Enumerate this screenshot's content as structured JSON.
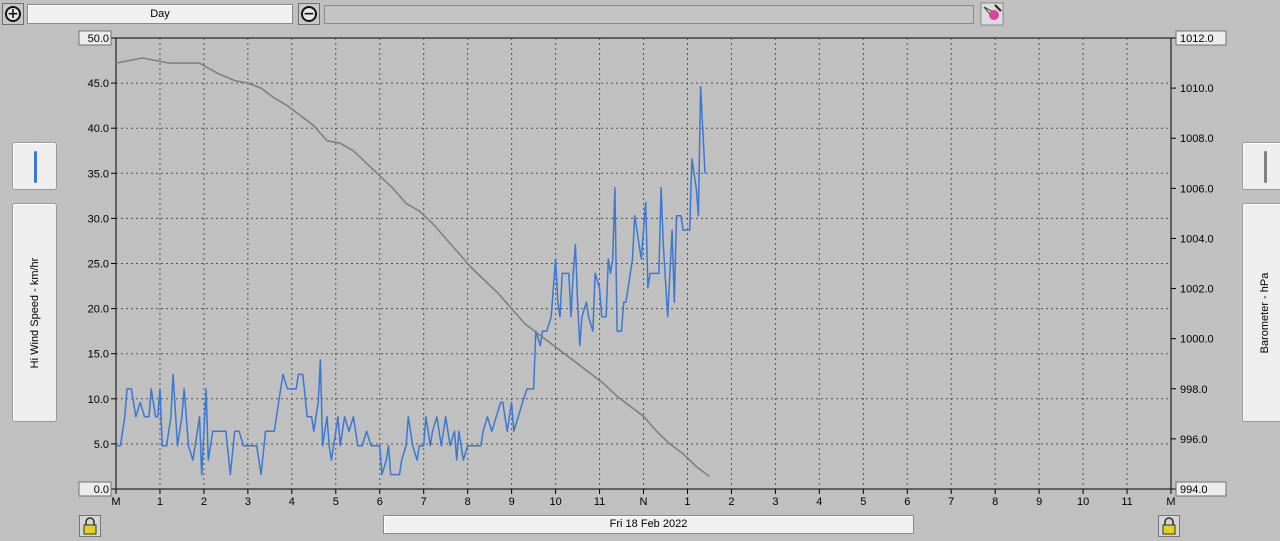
{
  "toolbar": {
    "period": "Day",
    "zoom_in_icon": "zoom-in-icon",
    "zoom_out_icon": "zoom-out-icon",
    "settings_icon": "paint-tool-icon"
  },
  "footer": {
    "date": "Fri 18 Feb 2022"
  },
  "left_panel": {
    "label": "Hi Wind Speed - km/hr",
    "color": "#3a78d4"
  },
  "right_panel": {
    "label": "Barometer - hPa",
    "color": "#808080"
  },
  "chart_data": {
    "type": "line",
    "left_axis": {
      "label": "Hi Wind Speed - km/hr",
      "min": 0,
      "max": 50,
      "ticks": [
        "0.0",
        "5.0",
        "10.0",
        "15.0",
        "20.0",
        "25.0",
        "30.0",
        "35.0",
        "40.0",
        "45.0",
        "50.0"
      ]
    },
    "right_axis": {
      "label": "Barometer - hPa",
      "min": 994,
      "max": 1012,
      "ticks": [
        "994.0",
        "996.0",
        "998.0",
        "1000.0",
        "1002.0",
        "1004.0",
        "1006.0",
        "1008.0",
        "1010.0",
        "1012.0"
      ]
    },
    "x_axis": {
      "min": 0,
      "max": 24,
      "ticks": [
        "M",
        "1",
        "2",
        "3",
        "4",
        "5",
        "6",
        "7",
        "8",
        "9",
        "10",
        "11",
        "N",
        "1",
        "2",
        "3",
        "4",
        "5",
        "6",
        "7",
        "8",
        "9",
        "10",
        "11",
        "M"
      ]
    },
    "grid": true,
    "series": [
      {
        "name": "Hi Wind Speed - km/hr",
        "axis": "left",
        "color": "#3a78d4",
        "points": [
          [
            0,
            4.8
          ],
          [
            0.1,
            4.8
          ],
          [
            0.2,
            8.0
          ],
          [
            0.25,
            11.1
          ],
          [
            0.35,
            11.1
          ],
          [
            0.45,
            8.0
          ],
          [
            0.55,
            9.6
          ],
          [
            0.65,
            8.0
          ],
          [
            0.75,
            8.0
          ],
          [
            0.8,
            11.1
          ],
          [
            0.9,
            8.0
          ],
          [
            0.95,
            8.0
          ],
          [
            1.0,
            11.1
          ],
          [
            1.05,
            4.8
          ],
          [
            1.15,
            4.8
          ],
          [
            1.25,
            8.0
          ],
          [
            1.3,
            12.7
          ],
          [
            1.4,
            4.8
          ],
          [
            1.5,
            8.0
          ],
          [
            1.55,
            11.1
          ],
          [
            1.65,
            4.8
          ],
          [
            1.75,
            3.2
          ],
          [
            1.85,
            6.4
          ],
          [
            1.9,
            8.0
          ],
          [
            1.95,
            1.6
          ],
          [
            2.05,
            11.1
          ],
          [
            2.1,
            3.2
          ],
          [
            2.2,
            6.4
          ],
          [
            2.3,
            6.4
          ],
          [
            2.4,
            6.4
          ],
          [
            2.5,
            6.4
          ],
          [
            2.6,
            1.6
          ],
          [
            2.7,
            6.4
          ],
          [
            2.8,
            6.4
          ],
          [
            2.9,
            4.8
          ],
          [
            3.0,
            4.8
          ],
          [
            3.1,
            4.8
          ],
          [
            3.2,
            4.8
          ],
          [
            3.3,
            1.6
          ],
          [
            3.4,
            6.4
          ],
          [
            3.5,
            6.4
          ],
          [
            3.6,
            6.4
          ],
          [
            3.7,
            9.6
          ],
          [
            3.8,
            12.7
          ],
          [
            3.9,
            11.1
          ],
          [
            4.0,
            11.1
          ],
          [
            4.1,
            11.1
          ],
          [
            4.15,
            12.7
          ],
          [
            4.25,
            12.7
          ],
          [
            4.35,
            8.0
          ],
          [
            4.45,
            8.0
          ],
          [
            4.5,
            6.4
          ],
          [
            4.6,
            9.6
          ],
          [
            4.65,
            14.3
          ],
          [
            4.7,
            4.8
          ],
          [
            4.8,
            8.0
          ],
          [
            4.85,
            4.8
          ],
          [
            4.9,
            3.2
          ],
          [
            5.0,
            6.4
          ],
          [
            5.05,
            8.0
          ],
          [
            5.1,
            4.8
          ],
          [
            5.2,
            8.0
          ],
          [
            5.3,
            6.4
          ],
          [
            5.4,
            8.0
          ],
          [
            5.5,
            4.8
          ],
          [
            5.6,
            4.8
          ],
          [
            5.7,
            6.4
          ],
          [
            5.8,
            4.8
          ],
          [
            5.9,
            4.8
          ],
          [
            6.0,
            4.8
          ],
          [
            6.05,
            1.6
          ],
          [
            6.15,
            3.2
          ],
          [
            6.2,
            4.8
          ],
          [
            6.25,
            1.6
          ],
          [
            6.35,
            1.6
          ],
          [
            6.45,
            1.6
          ],
          [
            6.5,
            3.2
          ],
          [
            6.6,
            4.8
          ],
          [
            6.65,
            8.0
          ],
          [
            6.75,
            4.8
          ],
          [
            6.85,
            3.2
          ],
          [
            6.9,
            4.8
          ],
          [
            7.0,
            4.8
          ],
          [
            7.05,
            8.0
          ],
          [
            7.15,
            4.8
          ],
          [
            7.2,
            6.4
          ],
          [
            7.3,
            8.0
          ],
          [
            7.4,
            4.8
          ],
          [
            7.5,
            8.0
          ],
          [
            7.6,
            4.8
          ],
          [
            7.7,
            6.4
          ],
          [
            7.75,
            3.2
          ],
          [
            7.8,
            6.4
          ],
          [
            7.9,
            3.2
          ],
          [
            8.0,
            4.8
          ],
          [
            8.1,
            4.8
          ],
          [
            8.2,
            4.8
          ],
          [
            8.3,
            4.8
          ],
          [
            8.35,
            6.4
          ],
          [
            8.45,
            8.0
          ],
          [
            8.55,
            6.4
          ],
          [
            8.65,
            8.0
          ],
          [
            8.75,
            9.6
          ],
          [
            8.8,
            9.6
          ],
          [
            8.9,
            6.4
          ],
          [
            9.0,
            9.6
          ],
          [
            9.05,
            6.4
          ],
          [
            9.15,
            8.0
          ],
          [
            9.25,
            9.6
          ],
          [
            9.35,
            11.1
          ],
          [
            9.4,
            11.1
          ],
          [
            9.5,
            11.1
          ],
          [
            9.55,
            17.5
          ],
          [
            9.65,
            15.9
          ],
          [
            9.7,
            17.5
          ],
          [
            9.8,
            17.5
          ],
          [
            9.9,
            19.1
          ],
          [
            10.0,
            25.5
          ],
          [
            10.05,
            20.7
          ],
          [
            10.1,
            19.1
          ],
          [
            10.15,
            23.9
          ],
          [
            10.2,
            23.9
          ],
          [
            10.3,
            23.9
          ],
          [
            10.35,
            19.1
          ],
          [
            10.4,
            23.9
          ],
          [
            10.45,
            27.1
          ],
          [
            10.5,
            20.7
          ],
          [
            10.55,
            15.9
          ],
          [
            10.6,
            19.1
          ],
          [
            10.7,
            20.7
          ],
          [
            10.75,
            19.1
          ],
          [
            10.85,
            17.5
          ],
          [
            10.9,
            23.9
          ],
          [
            11.0,
            22.3
          ],
          [
            11.05,
            19.1
          ],
          [
            11.15,
            19.1
          ],
          [
            11.2,
            25.5
          ],
          [
            11.25,
            23.9
          ],
          [
            11.3,
            25.5
          ],
          [
            11.35,
            33.4
          ],
          [
            11.4,
            17.5
          ],
          [
            11.5,
            17.5
          ],
          [
            11.55,
            20.7
          ],
          [
            11.6,
            20.7
          ],
          [
            11.7,
            23.9
          ],
          [
            11.75,
            25.5
          ],
          [
            11.8,
            30.3
          ],
          [
            11.85,
            28.7
          ],
          [
            11.95,
            25.5
          ],
          [
            12.0,
            28.7
          ],
          [
            12.05,
            31.8
          ],
          [
            12.1,
            22.3
          ],
          [
            12.15,
            23.9
          ],
          [
            12.25,
            23.9
          ],
          [
            12.35,
            23.9
          ],
          [
            12.4,
            33.4
          ],
          [
            12.45,
            27.1
          ],
          [
            12.55,
            19.1
          ],
          [
            12.65,
            28.7
          ],
          [
            12.7,
            20.7
          ],
          [
            12.75,
            30.3
          ],
          [
            12.85,
            30.3
          ],
          [
            12.9,
            28.7
          ],
          [
            13.0,
            28.7
          ],
          [
            13.05,
            28.7
          ],
          [
            13.1,
            36.6
          ],
          [
            13.2,
            33.4
          ],
          [
            13.25,
            30.3
          ],
          [
            13.3,
            44.6
          ],
          [
            13.4,
            35.0
          ]
        ]
      },
      {
        "name": "Barometer - hPa",
        "axis": "right",
        "color": "#808080",
        "points": [
          [
            0,
            1011.0
          ],
          [
            0.3,
            1011.1
          ],
          [
            0.6,
            1011.2
          ],
          [
            0.9,
            1011.1
          ],
          [
            1.2,
            1011.0
          ],
          [
            1.6,
            1011.0
          ],
          [
            1.9,
            1011.0
          ],
          [
            2.3,
            1010.6
          ],
          [
            2.7,
            1010.3
          ],
          [
            3.0,
            1010.2
          ],
          [
            3.3,
            1010.0
          ],
          [
            3.6,
            1009.6
          ],
          [
            3.9,
            1009.3
          ],
          [
            4.2,
            1008.9
          ],
          [
            4.5,
            1008.5
          ],
          [
            4.8,
            1007.9
          ],
          [
            5.1,
            1007.8
          ],
          [
            5.4,
            1007.5
          ],
          [
            5.7,
            1007.0
          ],
          [
            6.0,
            1006.5
          ],
          [
            6.3,
            1006.0
          ],
          [
            6.6,
            1005.4
          ],
          [
            6.9,
            1005.1
          ],
          [
            7.2,
            1004.6
          ],
          [
            7.5,
            1004.0
          ],
          [
            7.8,
            1003.4
          ],
          [
            8.1,
            1002.8
          ],
          [
            8.4,
            1002.3
          ],
          [
            8.7,
            1001.8
          ],
          [
            9.0,
            1001.2
          ],
          [
            9.3,
            1000.6
          ],
          [
            9.6,
            1000.2
          ],
          [
            9.9,
            999.8
          ],
          [
            10.2,
            999.4
          ],
          [
            10.5,
            999.0
          ],
          [
            10.8,
            998.6
          ],
          [
            11.1,
            998.2
          ],
          [
            11.4,
            997.7
          ],
          [
            11.7,
            997.3
          ],
          [
            12.0,
            996.9
          ],
          [
            12.3,
            996.3
          ],
          [
            12.6,
            995.8
          ],
          [
            12.9,
            995.4
          ],
          [
            13.2,
            994.9
          ],
          [
            13.5,
            994.5
          ]
        ]
      }
    ]
  }
}
